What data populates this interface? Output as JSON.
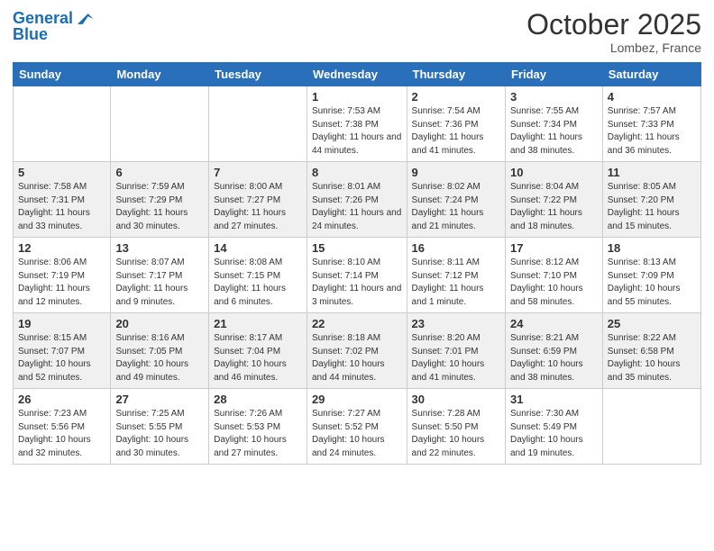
{
  "header": {
    "logo_line1": "General",
    "logo_line2": "Blue",
    "month_title": "October 2025",
    "location": "Lombez, France"
  },
  "weekdays": [
    "Sunday",
    "Monday",
    "Tuesday",
    "Wednesday",
    "Thursday",
    "Friday",
    "Saturday"
  ],
  "weeks": [
    [
      {
        "day": "",
        "sunrise": "",
        "sunset": "",
        "daylight": ""
      },
      {
        "day": "",
        "sunrise": "",
        "sunset": "",
        "daylight": ""
      },
      {
        "day": "",
        "sunrise": "",
        "sunset": "",
        "daylight": ""
      },
      {
        "day": "1",
        "sunrise": "Sunrise: 7:53 AM",
        "sunset": "Sunset: 7:38 PM",
        "daylight": "Daylight: 11 hours and 44 minutes."
      },
      {
        "day": "2",
        "sunrise": "Sunrise: 7:54 AM",
        "sunset": "Sunset: 7:36 PM",
        "daylight": "Daylight: 11 hours and 41 minutes."
      },
      {
        "day": "3",
        "sunrise": "Sunrise: 7:55 AM",
        "sunset": "Sunset: 7:34 PM",
        "daylight": "Daylight: 11 hours and 38 minutes."
      },
      {
        "day": "4",
        "sunrise": "Sunrise: 7:57 AM",
        "sunset": "Sunset: 7:33 PM",
        "daylight": "Daylight: 11 hours and 36 minutes."
      }
    ],
    [
      {
        "day": "5",
        "sunrise": "Sunrise: 7:58 AM",
        "sunset": "Sunset: 7:31 PM",
        "daylight": "Daylight: 11 hours and 33 minutes."
      },
      {
        "day": "6",
        "sunrise": "Sunrise: 7:59 AM",
        "sunset": "Sunset: 7:29 PM",
        "daylight": "Daylight: 11 hours and 30 minutes."
      },
      {
        "day": "7",
        "sunrise": "Sunrise: 8:00 AM",
        "sunset": "Sunset: 7:27 PM",
        "daylight": "Daylight: 11 hours and 27 minutes."
      },
      {
        "day": "8",
        "sunrise": "Sunrise: 8:01 AM",
        "sunset": "Sunset: 7:26 PM",
        "daylight": "Daylight: 11 hours and 24 minutes."
      },
      {
        "day": "9",
        "sunrise": "Sunrise: 8:02 AM",
        "sunset": "Sunset: 7:24 PM",
        "daylight": "Daylight: 11 hours and 21 minutes."
      },
      {
        "day": "10",
        "sunrise": "Sunrise: 8:04 AM",
        "sunset": "Sunset: 7:22 PM",
        "daylight": "Daylight: 11 hours and 18 minutes."
      },
      {
        "day": "11",
        "sunrise": "Sunrise: 8:05 AM",
        "sunset": "Sunset: 7:20 PM",
        "daylight": "Daylight: 11 hours and 15 minutes."
      }
    ],
    [
      {
        "day": "12",
        "sunrise": "Sunrise: 8:06 AM",
        "sunset": "Sunset: 7:19 PM",
        "daylight": "Daylight: 11 hours and 12 minutes."
      },
      {
        "day": "13",
        "sunrise": "Sunrise: 8:07 AM",
        "sunset": "Sunset: 7:17 PM",
        "daylight": "Daylight: 11 hours and 9 minutes."
      },
      {
        "day": "14",
        "sunrise": "Sunrise: 8:08 AM",
        "sunset": "Sunset: 7:15 PM",
        "daylight": "Daylight: 11 hours and 6 minutes."
      },
      {
        "day": "15",
        "sunrise": "Sunrise: 8:10 AM",
        "sunset": "Sunset: 7:14 PM",
        "daylight": "Daylight: 11 hours and 3 minutes."
      },
      {
        "day": "16",
        "sunrise": "Sunrise: 8:11 AM",
        "sunset": "Sunset: 7:12 PM",
        "daylight": "Daylight: 11 hours and 1 minute."
      },
      {
        "day": "17",
        "sunrise": "Sunrise: 8:12 AM",
        "sunset": "Sunset: 7:10 PM",
        "daylight": "Daylight: 10 hours and 58 minutes."
      },
      {
        "day": "18",
        "sunrise": "Sunrise: 8:13 AM",
        "sunset": "Sunset: 7:09 PM",
        "daylight": "Daylight: 10 hours and 55 minutes."
      }
    ],
    [
      {
        "day": "19",
        "sunrise": "Sunrise: 8:15 AM",
        "sunset": "Sunset: 7:07 PM",
        "daylight": "Daylight: 10 hours and 52 minutes."
      },
      {
        "day": "20",
        "sunrise": "Sunrise: 8:16 AM",
        "sunset": "Sunset: 7:05 PM",
        "daylight": "Daylight: 10 hours and 49 minutes."
      },
      {
        "day": "21",
        "sunrise": "Sunrise: 8:17 AM",
        "sunset": "Sunset: 7:04 PM",
        "daylight": "Daylight: 10 hours and 46 minutes."
      },
      {
        "day": "22",
        "sunrise": "Sunrise: 8:18 AM",
        "sunset": "Sunset: 7:02 PM",
        "daylight": "Daylight: 10 hours and 44 minutes."
      },
      {
        "day": "23",
        "sunrise": "Sunrise: 8:20 AM",
        "sunset": "Sunset: 7:01 PM",
        "daylight": "Daylight: 10 hours and 41 minutes."
      },
      {
        "day": "24",
        "sunrise": "Sunrise: 8:21 AM",
        "sunset": "Sunset: 6:59 PM",
        "daylight": "Daylight: 10 hours and 38 minutes."
      },
      {
        "day": "25",
        "sunrise": "Sunrise: 8:22 AM",
        "sunset": "Sunset: 6:58 PM",
        "daylight": "Daylight: 10 hours and 35 minutes."
      }
    ],
    [
      {
        "day": "26",
        "sunrise": "Sunrise: 7:23 AM",
        "sunset": "Sunset: 5:56 PM",
        "daylight": "Daylight: 10 hours and 32 minutes."
      },
      {
        "day": "27",
        "sunrise": "Sunrise: 7:25 AM",
        "sunset": "Sunset: 5:55 PM",
        "daylight": "Daylight: 10 hours and 30 minutes."
      },
      {
        "day": "28",
        "sunrise": "Sunrise: 7:26 AM",
        "sunset": "Sunset: 5:53 PM",
        "daylight": "Daylight: 10 hours and 27 minutes."
      },
      {
        "day": "29",
        "sunrise": "Sunrise: 7:27 AM",
        "sunset": "Sunset: 5:52 PM",
        "daylight": "Daylight: 10 hours and 24 minutes."
      },
      {
        "day": "30",
        "sunrise": "Sunrise: 7:28 AM",
        "sunset": "Sunset: 5:50 PM",
        "daylight": "Daylight: 10 hours and 22 minutes."
      },
      {
        "day": "31",
        "sunrise": "Sunrise: 7:30 AM",
        "sunset": "Sunset: 5:49 PM",
        "daylight": "Daylight: 10 hours and 19 minutes."
      },
      {
        "day": "",
        "sunrise": "",
        "sunset": "",
        "daylight": ""
      }
    ]
  ]
}
